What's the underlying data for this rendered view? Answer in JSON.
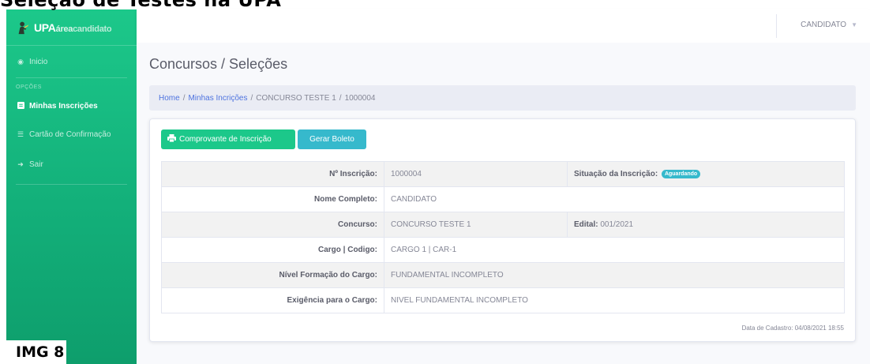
{
  "overlay": {
    "cut_title": "Seleção de Testes na UPA",
    "img_label": "IMG 8"
  },
  "brand": {
    "prefix": "UPA",
    "word1": "área",
    "word2": "candidato"
  },
  "sidebar": {
    "items": [
      {
        "label": "Inicio",
        "icon": "dashboard-icon"
      },
      {
        "heading": "OPÇÕES"
      },
      {
        "label": "Minhas Inscrições",
        "icon": "folder-icon",
        "active": true
      },
      {
        "label": "Cartão de Confirmação",
        "icon": "list-icon"
      },
      {
        "label": "Sair",
        "icon": "sign-out-icon"
      }
    ]
  },
  "topbar": {
    "user": "CANDIDATO"
  },
  "page": {
    "title": "Concursos / Seleções"
  },
  "breadcrumb": {
    "home": "Home",
    "sep": "/",
    "inscricoes": "Minhas Incrições",
    "concurso": "CONCURSO TESTE 1",
    "numero": "1000004"
  },
  "actions": {
    "comprovante": "Comprovante de Inscrição",
    "boleto": "Gerar Boleto"
  },
  "details": {
    "n_inscricao_label": "Nº Inscrição:",
    "n_inscricao": "1000004",
    "situacao_label": "Situação da Inscrição:",
    "situacao": "Aguardando",
    "nome_label": "Nome Completo:",
    "nome": "CANDIDATO",
    "concurso_label": "Concurso:",
    "concurso": "CONCURSO TESTE 1",
    "edital_label": "Edital:",
    "edital": "001/2021",
    "cargo_label": "Cargo | Codigo:",
    "cargo": "CARGO 1 | CAR-1",
    "nivel_label": "Nível Formação do Cargo:",
    "nivel": "FUNDAMENTAL INCOMPLETO",
    "exigencia_label": "Exigência para o Cargo:",
    "exigencia": "NIVEL FUNDAMENTAL INCOMPLETO"
  },
  "footer": {
    "cadastro": "Data de Cadastro: 04/08/2021 18:55"
  },
  "colors": {
    "sidebar": "#1cc88a",
    "primary_link": "#4e73df",
    "success": "#1cc88a",
    "info": "#36b9cc"
  }
}
